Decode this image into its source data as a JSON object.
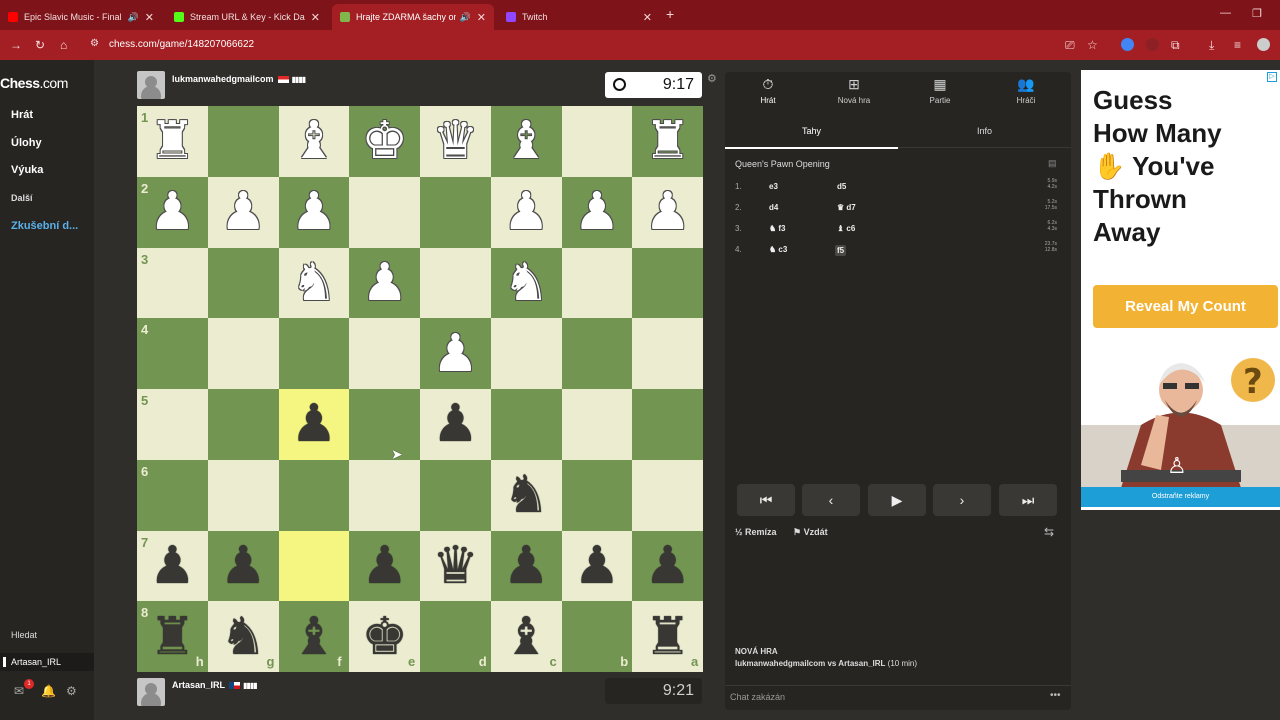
{
  "browser": {
    "tabs": [
      {
        "label": "Epic Slavic Music - Final Ho",
        "fav_color": "#ff0000"
      },
      {
        "label": "Stream URL & Key - Kick Dashb",
        "fav_color": "#53fc18"
      },
      {
        "label": "Hrajte ZDARMA šachy onlin",
        "fav_color": "#81b64c"
      },
      {
        "label": "Twitch",
        "fav_color": "#9146ff"
      }
    ],
    "url": "chess.com/game/148207066622"
  },
  "sidebar": {
    "logo_main": "Chess",
    "logo_suffix": ".com",
    "items": [
      "Hrát",
      "Úlohy",
      "Výuka",
      "Další",
      "Zkušební d..."
    ],
    "search": "Hledat",
    "user": "Artasan_IRL",
    "mail_badge": "1"
  },
  "game": {
    "top_player": "lukmanwahedgmailcom",
    "bottom_player": "Artasan_IRL",
    "top_clock": "9:17",
    "bottom_clock": "9:21",
    "ranks": [
      "1",
      "2",
      "3",
      "4",
      "5",
      "6",
      "7",
      "8"
    ],
    "files": [
      "h",
      "g",
      "f",
      "e",
      "d",
      "c",
      "b",
      "a"
    ]
  },
  "panel": {
    "tabs": [
      "Hrát",
      "Nová hra",
      "Partie",
      "Hráči"
    ],
    "subtabs": [
      "Tahy",
      "Info"
    ],
    "opening": "Queen's Pawn Opening",
    "moves": [
      {
        "n": "1.",
        "w": "e3",
        "b": "d5",
        "t1": "5.9s",
        "t2": "4.2s"
      },
      {
        "n": "2.",
        "w": "d4",
        "b": "♛ d7",
        "t1": "5.2s",
        "t2": "17.5s"
      },
      {
        "n": "3.",
        "w": "♞ f3",
        "b": "♝ c6",
        "t1": "6.2s",
        "t2": "4.3s"
      },
      {
        "n": "4.",
        "w": "♞ c3",
        "b": "f5",
        "t1": "23.7s",
        "t2": "12.8s"
      }
    ],
    "draw": "Remíza",
    "resign": "Vzdát",
    "new_game_label": "NOVÁ HRA",
    "game_players": "lukmanwahedgmailcom vs Artasan_IRL",
    "game_time": "(10 min)",
    "chat": "Chat zakázán"
  },
  "ad": {
    "line1": "Guess",
    "line2": "How Many",
    "line3": "You've",
    "line4": "Thrown",
    "line5": "Away",
    "button": "Reveal My Count",
    "remove": "Odstraňte reklamy"
  },
  "colors": {
    "light_square": "#ebecd0",
    "dark_square": "#739552",
    "highlight": "#f5f682",
    "ad_button": "#f2b233"
  }
}
